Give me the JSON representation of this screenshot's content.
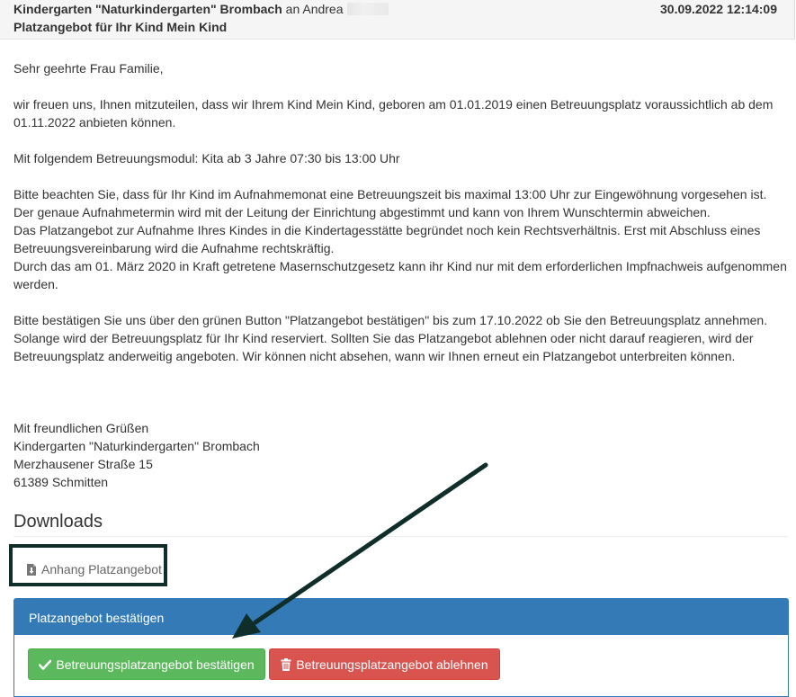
{
  "header": {
    "sender": "Kindergarten \"Naturkindergarten\" Brombach",
    "recipient": "an Andrea",
    "date": "30.09.2022 12:14:09",
    "subject": "Platzangebot für Ihr Kind Mein Kind"
  },
  "message": {
    "greeting": "Sehr geehrte Frau Familie,",
    "paragraph_1": "wir freuen uns, Ihnen mitzuteilen, dass wir Ihrem Kind Mein Kind, geboren am 01.01.2019 einen Betreuungsplatz voraussichtlich ab dem 01.11.2022 anbieten können.",
    "paragraph_2": "Mit folgendem Betreuungsmodul: Kita ab 3 Jahre 07:30 bis 13:00 Uhr",
    "paragraph_3_lines": [
      "Bitte beachten Sie, dass für Ihr Kind im Aufnahmemonat eine Betreuungszeit bis maximal 13:00 Uhr zur Eingewöhnung vorgesehen ist.",
      "Der genaue Aufnahmetermin wird mit der Leitung der Einrichtung abgestimmt und kann von Ihrem Wunschtermin abweichen.",
      "Das Platzangebot zur Aufnahme Ihres Kindes in die Kindertagesstätte begründet noch kein Rechtsverhältnis. Erst mit Abschluss eines Betreuungsvereinbarung wird die Aufnahme rechtskräftig.",
      "Durch das am 01. März 2020 in Kraft getretene Masernschutzgesetz kann ihr Kind nur mit dem erforderlichen Impfnachweis aufgenommen werden."
    ],
    "paragraph_4": "Bitte bestätigen Sie uns über den grünen Button \"Platzangebot bestätigen\" bis zum 17.10.2022 ob Sie den Betreuungsplatz annehmen. Solange wird der Betreuungsplatz für Ihr Kind reserviert. Sollten Sie das Platzangebot ablehnen oder nicht darauf reagieren, wird der Betreuungsplatz anderweitig angeboten. Wir können nicht absehen, wann wir Ihnen erneut ein Platzangebot unterbreiten können.",
    "closing": "Mit freundlichen Grüßen",
    "signature_lines": [
      "Kindergarten \"Naturkindergarten\" Brombach",
      "Merzhausener Straße 15",
      "61389 Schmitten"
    ]
  },
  "downloads": {
    "title": "Downloads",
    "attachment_label": "Anhang Platzangebot",
    "attachment_icon": "file-download-icon"
  },
  "confirm_panel": {
    "title": "Platzangebot bestätigen",
    "accept_label": "Betreuungsplatzangebot bestätigen",
    "accept_icon": "check-icon",
    "reject_label": "Betreuungsplatzangebot ablehnen",
    "reject_icon": "trash-icon"
  },
  "colors": {
    "primary": "#337ab7",
    "success": "#5cb85c",
    "danger": "#d9534f",
    "annotation": "#0f2e2a"
  }
}
